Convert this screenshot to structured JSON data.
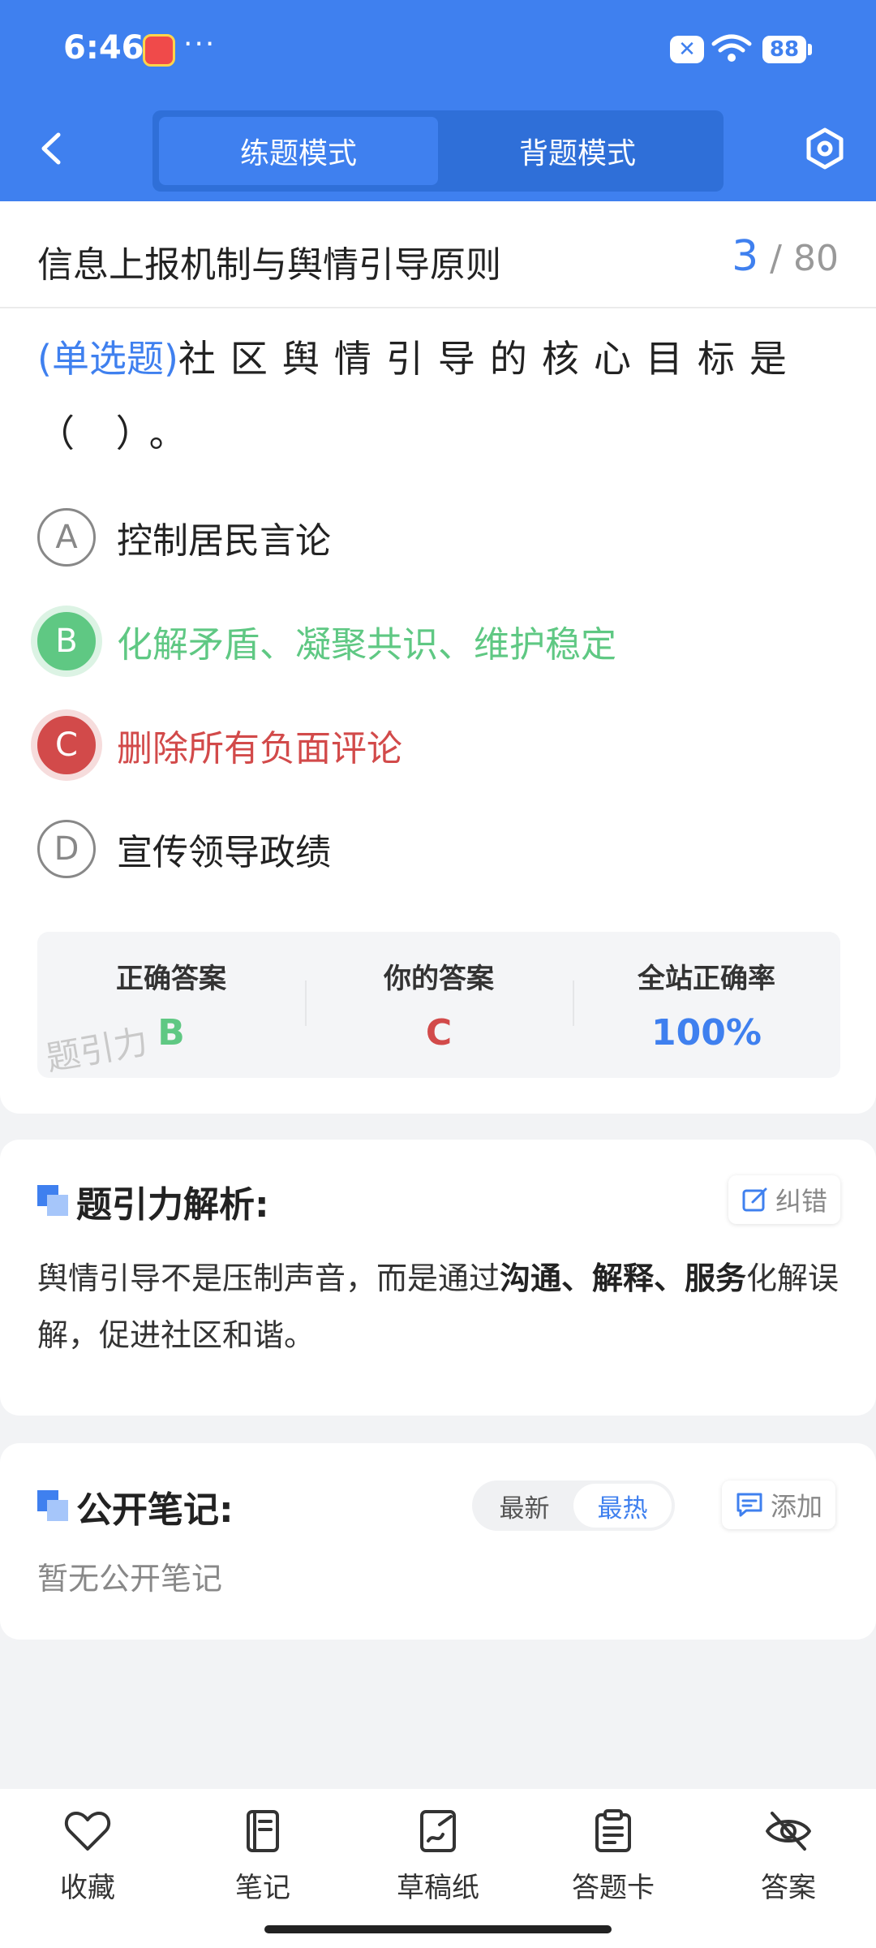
{
  "status_bar": {
    "time": "6:46",
    "dots": "···",
    "x_badge": "✕",
    "battery": "88"
  },
  "header": {
    "tabs": [
      {
        "label": "练题模式",
        "active": true
      },
      {
        "label": "背题模式",
        "active": false
      }
    ]
  },
  "question_header": {
    "section_title": "信息上报机制与舆情引导原则",
    "current": "3",
    "separator": "/",
    "total": "80"
  },
  "question": {
    "type_label": "(单选题)",
    "text": "社区舆情引导的核心目标是（    ）。",
    "options": [
      {
        "letter": "A",
        "text": "控制居民言论",
        "state": "normal"
      },
      {
        "letter": "B",
        "text": "化解矛盾、凝聚共识、维护稳定",
        "state": "correct"
      },
      {
        "letter": "C",
        "text": "删除所有负面评论",
        "state": "wrong"
      },
      {
        "letter": "D",
        "text": "宣传领导政绩",
        "state": "normal"
      }
    ]
  },
  "answer_panel": {
    "correct_label": "正确答案",
    "correct_value": "B",
    "yours_label": "你的答案",
    "yours_value": "C",
    "rate_label": "全站正确率",
    "rate_value": "100%"
  },
  "watermark": "题引力",
  "analysis": {
    "title": "题引力解析:",
    "report_button": "纠错",
    "text_before": "舆情引导不是压制声音，而是通过",
    "text_bold": "沟通、解释、服务",
    "text_after": "化解误解，促进社区和谐。"
  },
  "notes": {
    "title": "公开笔记:",
    "sort_options": [
      "最新",
      "最热"
    ],
    "active_sort": "最热",
    "add_button": "添加",
    "empty_text": "暂无公开笔记"
  },
  "bottom_bar": [
    {
      "label": "收藏",
      "icon": "heart-icon"
    },
    {
      "label": "笔记",
      "icon": "notebook-icon"
    },
    {
      "label": "草稿纸",
      "icon": "draft-icon"
    },
    {
      "label": "答题卡",
      "icon": "answer-sheet-icon"
    },
    {
      "label": "答案",
      "icon": "eye-off-icon"
    }
  ],
  "colors": {
    "primary": "#3f80ef",
    "correct": "#5fc883",
    "wrong": "#d24a4a"
  }
}
